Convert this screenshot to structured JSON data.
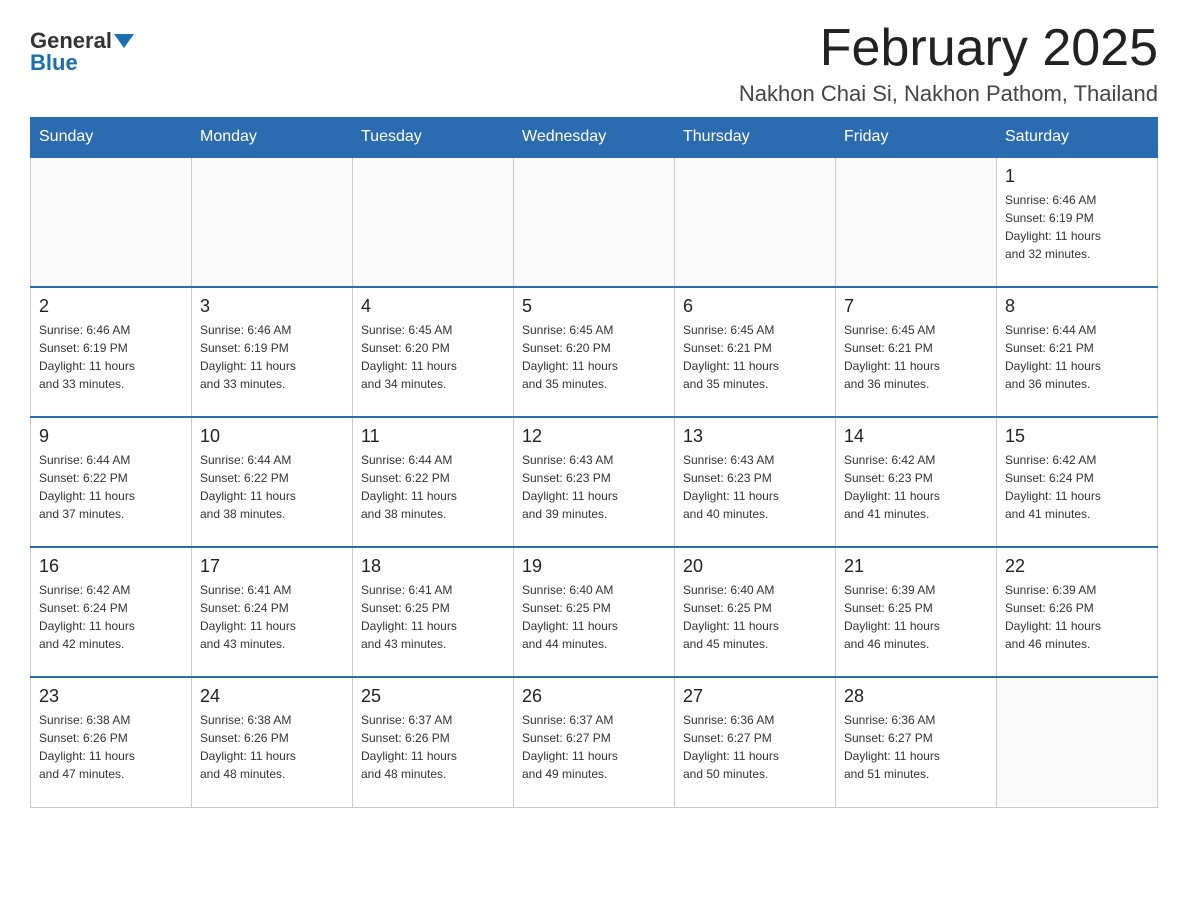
{
  "header": {
    "logo_general": "General",
    "logo_blue": "Blue",
    "month_title": "February 2025",
    "location": "Nakhon Chai Si, Nakhon Pathom, Thailand"
  },
  "weekdays": [
    "Sunday",
    "Monday",
    "Tuesday",
    "Wednesday",
    "Thursday",
    "Friday",
    "Saturday"
  ],
  "weeks": [
    [
      {
        "day": "",
        "info": ""
      },
      {
        "day": "",
        "info": ""
      },
      {
        "day": "",
        "info": ""
      },
      {
        "day": "",
        "info": ""
      },
      {
        "day": "",
        "info": ""
      },
      {
        "day": "",
        "info": ""
      },
      {
        "day": "1",
        "info": "Sunrise: 6:46 AM\nSunset: 6:19 PM\nDaylight: 11 hours\nand 32 minutes."
      }
    ],
    [
      {
        "day": "2",
        "info": "Sunrise: 6:46 AM\nSunset: 6:19 PM\nDaylight: 11 hours\nand 33 minutes."
      },
      {
        "day": "3",
        "info": "Sunrise: 6:46 AM\nSunset: 6:19 PM\nDaylight: 11 hours\nand 33 minutes."
      },
      {
        "day": "4",
        "info": "Sunrise: 6:45 AM\nSunset: 6:20 PM\nDaylight: 11 hours\nand 34 minutes."
      },
      {
        "day": "5",
        "info": "Sunrise: 6:45 AM\nSunset: 6:20 PM\nDaylight: 11 hours\nand 35 minutes."
      },
      {
        "day": "6",
        "info": "Sunrise: 6:45 AM\nSunset: 6:21 PM\nDaylight: 11 hours\nand 35 minutes."
      },
      {
        "day": "7",
        "info": "Sunrise: 6:45 AM\nSunset: 6:21 PM\nDaylight: 11 hours\nand 36 minutes."
      },
      {
        "day": "8",
        "info": "Sunrise: 6:44 AM\nSunset: 6:21 PM\nDaylight: 11 hours\nand 36 minutes."
      }
    ],
    [
      {
        "day": "9",
        "info": "Sunrise: 6:44 AM\nSunset: 6:22 PM\nDaylight: 11 hours\nand 37 minutes."
      },
      {
        "day": "10",
        "info": "Sunrise: 6:44 AM\nSunset: 6:22 PM\nDaylight: 11 hours\nand 38 minutes."
      },
      {
        "day": "11",
        "info": "Sunrise: 6:44 AM\nSunset: 6:22 PM\nDaylight: 11 hours\nand 38 minutes."
      },
      {
        "day": "12",
        "info": "Sunrise: 6:43 AM\nSunset: 6:23 PM\nDaylight: 11 hours\nand 39 minutes."
      },
      {
        "day": "13",
        "info": "Sunrise: 6:43 AM\nSunset: 6:23 PM\nDaylight: 11 hours\nand 40 minutes."
      },
      {
        "day": "14",
        "info": "Sunrise: 6:42 AM\nSunset: 6:23 PM\nDaylight: 11 hours\nand 41 minutes."
      },
      {
        "day": "15",
        "info": "Sunrise: 6:42 AM\nSunset: 6:24 PM\nDaylight: 11 hours\nand 41 minutes."
      }
    ],
    [
      {
        "day": "16",
        "info": "Sunrise: 6:42 AM\nSunset: 6:24 PM\nDaylight: 11 hours\nand 42 minutes."
      },
      {
        "day": "17",
        "info": "Sunrise: 6:41 AM\nSunset: 6:24 PM\nDaylight: 11 hours\nand 43 minutes."
      },
      {
        "day": "18",
        "info": "Sunrise: 6:41 AM\nSunset: 6:25 PM\nDaylight: 11 hours\nand 43 minutes."
      },
      {
        "day": "19",
        "info": "Sunrise: 6:40 AM\nSunset: 6:25 PM\nDaylight: 11 hours\nand 44 minutes."
      },
      {
        "day": "20",
        "info": "Sunrise: 6:40 AM\nSunset: 6:25 PM\nDaylight: 11 hours\nand 45 minutes."
      },
      {
        "day": "21",
        "info": "Sunrise: 6:39 AM\nSunset: 6:25 PM\nDaylight: 11 hours\nand 46 minutes."
      },
      {
        "day": "22",
        "info": "Sunrise: 6:39 AM\nSunset: 6:26 PM\nDaylight: 11 hours\nand 46 minutes."
      }
    ],
    [
      {
        "day": "23",
        "info": "Sunrise: 6:38 AM\nSunset: 6:26 PM\nDaylight: 11 hours\nand 47 minutes."
      },
      {
        "day": "24",
        "info": "Sunrise: 6:38 AM\nSunset: 6:26 PM\nDaylight: 11 hours\nand 48 minutes."
      },
      {
        "day": "25",
        "info": "Sunrise: 6:37 AM\nSunset: 6:26 PM\nDaylight: 11 hours\nand 48 minutes."
      },
      {
        "day": "26",
        "info": "Sunrise: 6:37 AM\nSunset: 6:27 PM\nDaylight: 11 hours\nand 49 minutes."
      },
      {
        "day": "27",
        "info": "Sunrise: 6:36 AM\nSunset: 6:27 PM\nDaylight: 11 hours\nand 50 minutes."
      },
      {
        "day": "28",
        "info": "Sunrise: 6:36 AM\nSunset: 6:27 PM\nDaylight: 11 hours\nand 51 minutes."
      },
      {
        "day": "",
        "info": ""
      }
    ]
  ]
}
